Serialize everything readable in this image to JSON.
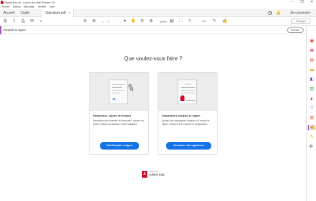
{
  "window": {
    "title": "Signature.pdf - Adobe Acrobat Reader DC",
    "minimize": "–",
    "maximize": "❐",
    "close": "✕"
  },
  "menu": [
    "Fichier",
    "Edition",
    "Affichage",
    "Fenêtre",
    "Aide"
  ],
  "tabs": {
    "home": "Accueil",
    "tools": "Outils",
    "document": "Signature.pdf",
    "close": "×",
    "sign_in": "Se connecter",
    "help": "?"
  },
  "toolbar": {
    "page_current": "1",
    "page_total": "/ 1",
    "zoom": "105%",
    "share": "Partager"
  },
  "tool_header": {
    "title": "Remplir et signer",
    "close": "Fermer"
  },
  "main": {
    "question": "Que voulez-vous faire ?",
    "card_fill": {
      "title": "Remplissez, signez et envoyez",
      "desc": "Remplissez les champs du formulaire, ajoutez du texte et tracez ou saisissez votre signature.",
      "button": "Outil Remplir et signer"
    },
    "card_request": {
      "title": "Demandez à d'autres de signer",
      "desc": "Ajoutez des signataires, indiquez où remplir et signer, envoyez-les et suivez la progression.",
      "button": "Demander des signatures"
    },
    "footer": {
      "powered_by": "Powered by",
      "brand": "Adobe Sign"
    }
  },
  "colors": {
    "accent_blue": "#1473e6",
    "fill_sign_purple": "#9b59b6",
    "adobe_red": "#c8102e"
  },
  "right_panel": {
    "icons": [
      "create-pdf-icon",
      "edit-pdf-icon",
      "export-pdf-icon",
      "comment-icon",
      "combine-files-icon",
      "organize-pages-icon",
      "send-for-review-icon",
      "protect-icon",
      "fill-sign-icon",
      "send-for-signature-icon",
      "more-tools-icon"
    ]
  }
}
